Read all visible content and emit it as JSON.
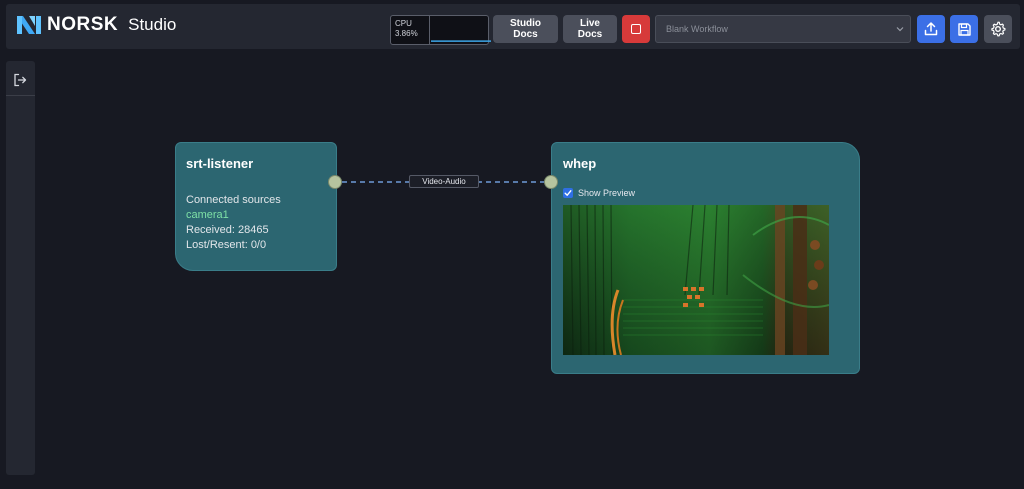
{
  "header": {
    "brand": "NORSK",
    "product": "Studio",
    "cpu": {
      "label": "CPU",
      "value": "3.86%",
      "level": 0.0386
    },
    "buttons": {
      "studio_docs": "Studio Docs",
      "live_docs": "Live Docs"
    },
    "workflow_select": {
      "value": "Blank Workflow"
    },
    "icons": [
      "upload-icon",
      "save-icon",
      "gear-icon",
      "stop-icon"
    ]
  },
  "sidebar": {
    "icons": [
      "exit-icon"
    ]
  },
  "nodes": {
    "srt": {
      "title": "srt-listener",
      "connected_label": "Connected sources",
      "source": "camera1",
      "received": "Received: 28465",
      "lost": "Lost/Resent: 0/0"
    },
    "whep": {
      "title": "whep",
      "show_preview_label": "Show Preview",
      "show_preview": true
    }
  },
  "edge": {
    "label": "Video-Audio"
  },
  "colors": {
    "background": "#171922",
    "node": "#2c6671",
    "accent_blue": "#3b6fe6",
    "stop_red": "#d73a3a",
    "source_green": "#7ee0a6"
  }
}
